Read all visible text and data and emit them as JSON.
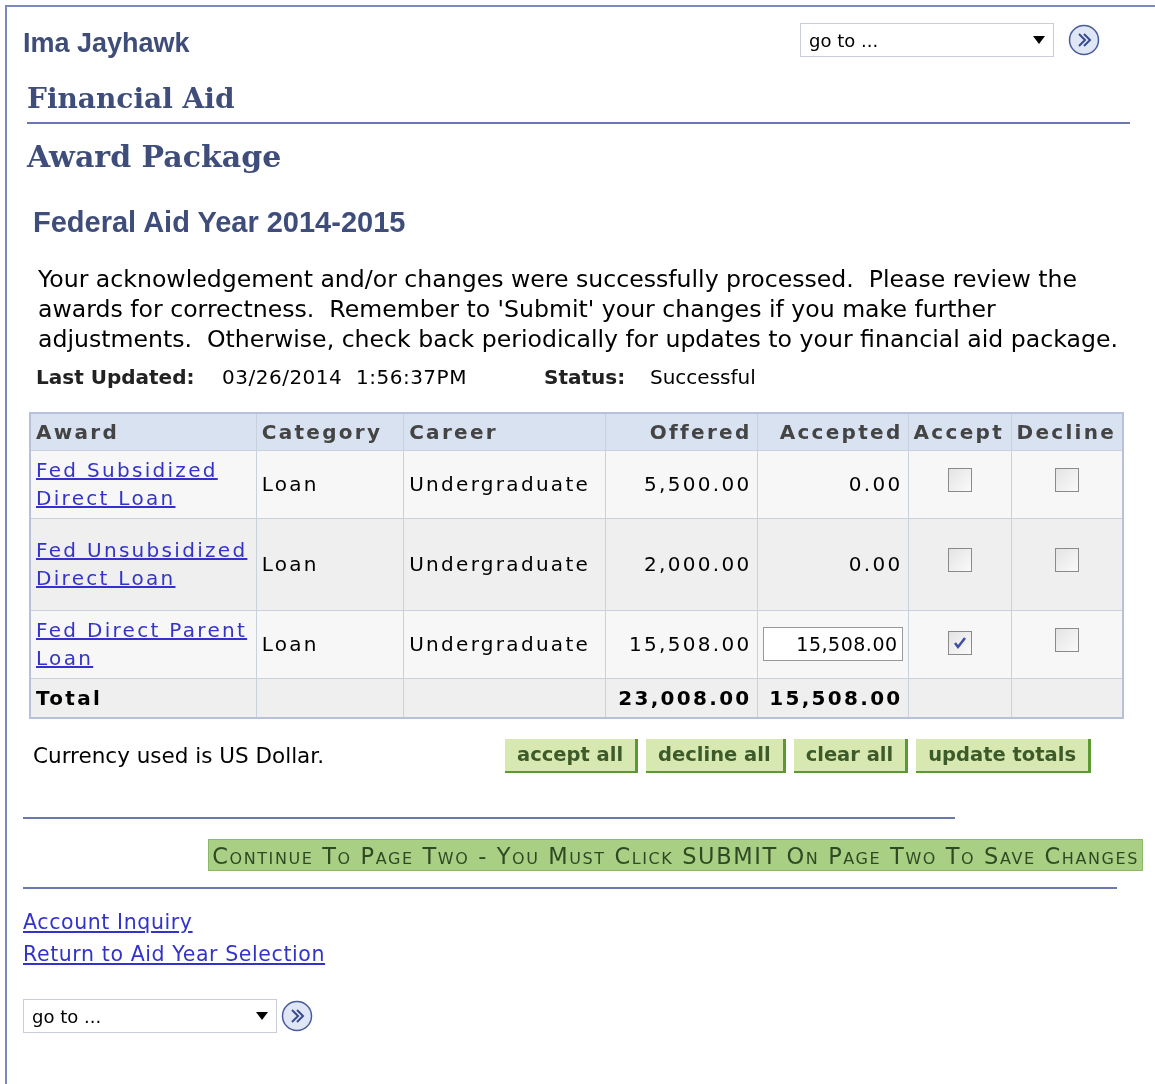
{
  "header": {
    "name": "Ima Jayhawk",
    "goto": {
      "value": "go to ..."
    }
  },
  "breadcrumb": "Financial Aid",
  "page_title": "Award Package",
  "aid_year": "Federal Aid Year 2014-2015",
  "message": "Your acknowledgement and/or changes were successfully processed.  Please review the awards for correctness.  Remember to 'Submit' your changes if you make further adjustments.  Otherwise, check back periodically for updates to your financial aid package.",
  "last_updated": {
    "label": "Last Updated:",
    "value": "03/26/2014  1:56:37PM"
  },
  "status": {
    "label": "Status:",
    "value": "Successful"
  },
  "table": {
    "columns": [
      "Award",
      "Category",
      "Career",
      "Offered",
      "Accepted",
      "Accept",
      "Decline"
    ],
    "rows": [
      {
        "award": "Fed Subsidized Direct Loan",
        "category": "Loan",
        "career": "Undergraduate",
        "offered": "5,500.00",
        "accepted": "0.00",
        "editable": false,
        "accept": false,
        "decline": false
      },
      {
        "award": "Fed Unsubsidized Direct Loan",
        "category": "Loan",
        "career": "Undergraduate",
        "offered": "2,000.00",
        "accepted": "0.00",
        "editable": false,
        "accept": false,
        "decline": false
      },
      {
        "award": "Fed Direct Parent Loan",
        "category": "Loan",
        "career": "Undergraduate",
        "offered": "15,508.00",
        "accepted": "15,508.00",
        "editable": true,
        "accept": true,
        "decline": false
      }
    ],
    "total": {
      "label": "Total",
      "offered": "23,008.00",
      "accepted": "15,508.00"
    }
  },
  "currency_note": "Currency used is US Dollar.",
  "buttons": [
    "accept all",
    "decline all",
    "clear all",
    "update totals"
  ],
  "continue_button": "Continue To Page Two - You Must Click SUBMIT On Page Two To Save Changes",
  "links": [
    "Account Inquiry",
    "Return to Aid Year Selection"
  ],
  "footer": {
    "goto": {
      "value": "go to ..."
    }
  }
}
